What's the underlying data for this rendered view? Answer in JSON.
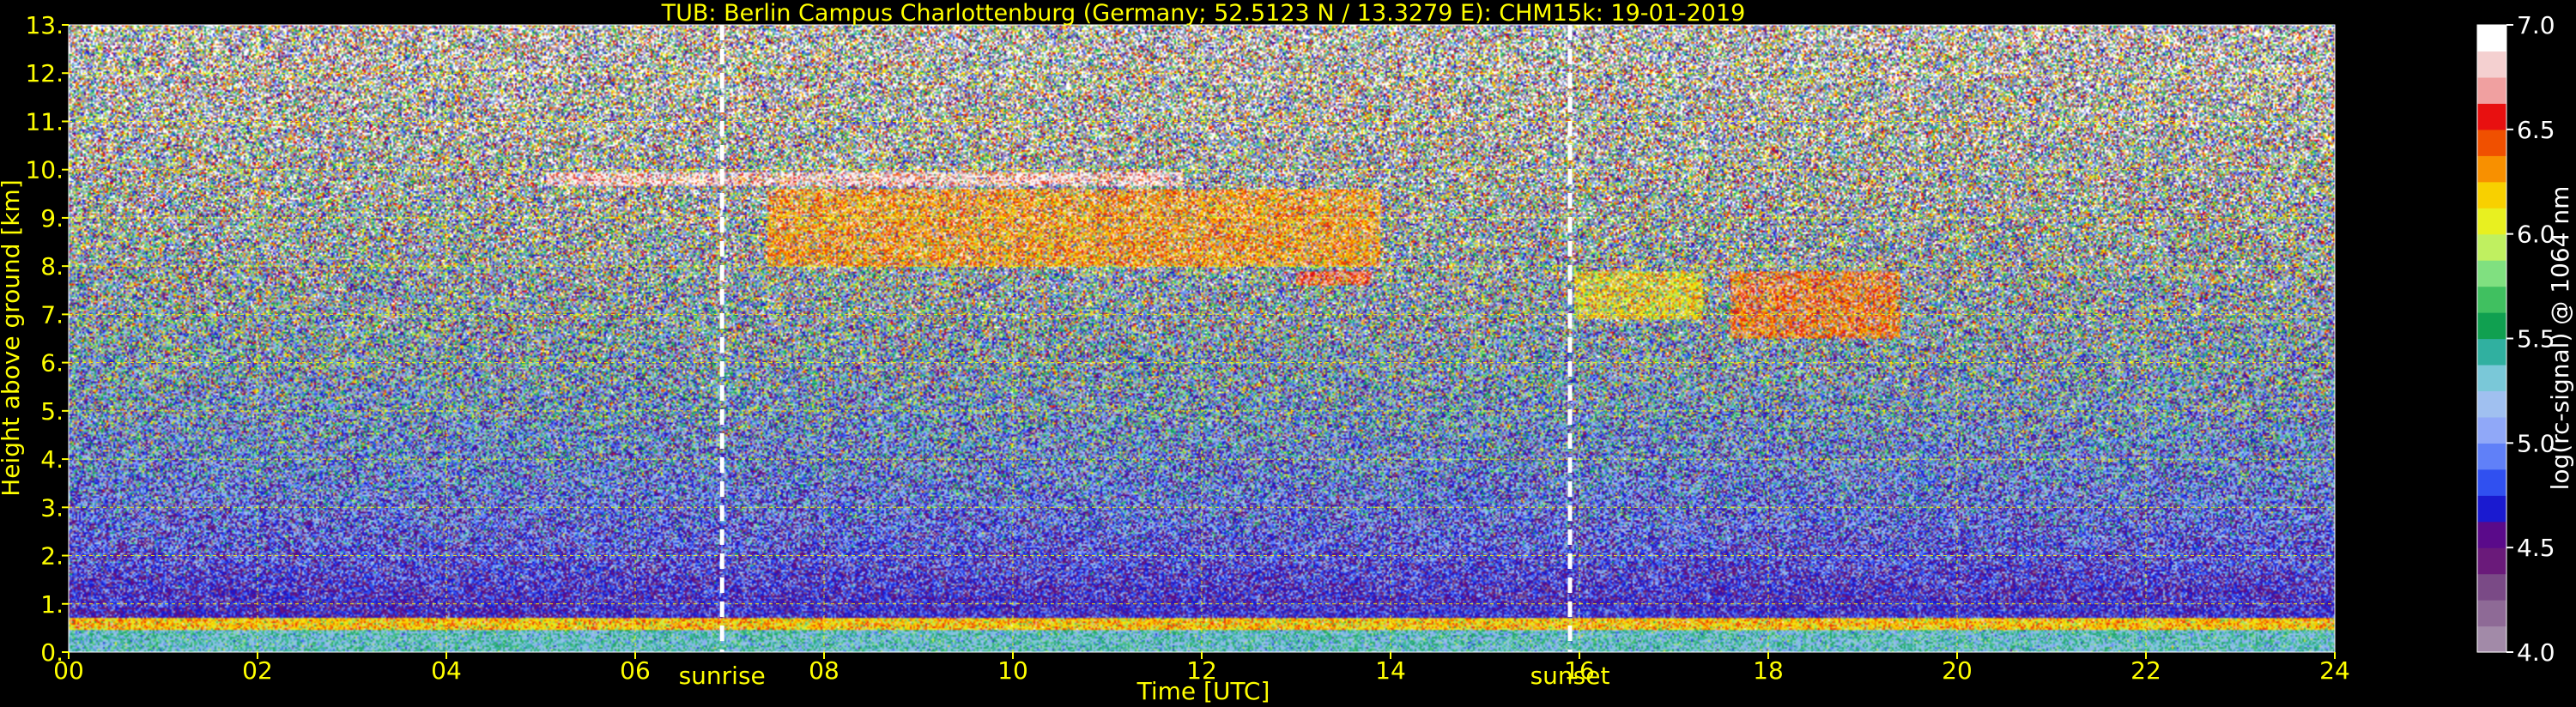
{
  "chart_data": {
    "type": "heatmap",
    "title": "TUB: Berlin Campus Charlottenburg (Germany; 52.5123 N / 13.3279 E):    CHM15k: 19-01-2019",
    "xlabel": "Time [UTC]",
    "ylabel": "Height above ground [km]",
    "xlim": [
      0,
      24
    ],
    "ylim": [
      0,
      13
    ],
    "x_ticks": [
      0,
      2,
      4,
      6,
      8,
      10,
      12,
      14,
      16,
      18,
      20,
      22,
      24
    ],
    "x_tick_labels": [
      "00",
      "02",
      "04",
      "06",
      "08",
      "10",
      "12",
      "14",
      "16",
      "18",
      "20",
      "22",
      "24"
    ],
    "y_ticks": [
      0,
      1,
      2,
      3,
      4,
      5,
      6,
      7,
      8,
      9,
      10,
      11,
      12,
      13
    ],
    "y_tick_labels": [
      "0.",
      "1.",
      "2.",
      "3.",
      "4.",
      "5.",
      "6.",
      "7.",
      "8.",
      "9.",
      "10.",
      "11.",
      "12.",
      "13."
    ],
    "grid": true,
    "colorbar": {
      "label": "log(rc-signal) @ 1064 nm",
      "range": [
        4.0,
        7.0
      ],
      "tick_values": [
        4.0,
        4.5,
        5.0,
        5.5,
        6.0,
        6.5,
        7.0
      ],
      "tick_labels": [
        "4.0",
        "4.5",
        "5.0",
        "5.5",
        "6.0",
        "6.5",
        "7.0"
      ],
      "placement": "right"
    },
    "annotations": [
      {
        "label": "sunrise",
        "time_utc": 6.92,
        "style": "dashed-white-vertical"
      },
      {
        "label": "sunset",
        "time_utc": 15.9,
        "style": "dashed-white-vertical"
      }
    ],
    "features": [
      {
        "kind": "cirrus-thin",
        "t_start": 5.05,
        "t_end": 11.8,
        "h_bottom": 9.65,
        "h_top": 9.95,
        "level": 6.8
      },
      {
        "kind": "cirrus",
        "t_start": 7.4,
        "t_end": 13.9,
        "h_bottom": 8.0,
        "h_top": 9.6,
        "level": 6.3
      },
      {
        "kind": "cirrus-tail",
        "t_start": 13.0,
        "t_end": 13.8,
        "h_bottom": 7.6,
        "h_top": 7.9,
        "level": 6.5
      },
      {
        "kind": "cloud-fragments",
        "t_start": 15.95,
        "t_end": 17.3,
        "h_bottom": 6.9,
        "h_top": 7.9,
        "level": 6.1
      },
      {
        "kind": "cloud",
        "t_start": 17.6,
        "t_end": 19.4,
        "h_bottom": 6.5,
        "h_top": 7.9,
        "level": 6.4
      },
      {
        "kind": "boundary-layer-top",
        "t_start": 0.0,
        "t_end": 24.0,
        "h_bottom": 0.45,
        "h_top": 0.7,
        "level": 6.2
      },
      {
        "kind": "residual-layer",
        "t_start": 5.5,
        "t_end": 24.0,
        "h_bottom": 0.7,
        "h_top": 1.0,
        "level": 4.7
      },
      {
        "kind": "aerosol-near-ground",
        "t_start": 0.0,
        "t_end": 24.0,
        "h_bottom": 0.0,
        "h_top": 0.45,
        "level": 5.35
      }
    ]
  },
  "colors": {
    "axis_text": "#ffff00",
    "colorbar_text": "#ffffff",
    "grid": "#ffff00",
    "background": "#000000",
    "colormap": [
      "#a28aa8",
      "#8e6a96",
      "#7a4a86",
      "#6a1a7a",
      "#5a0a8a",
      "#1a1ad0",
      "#3050f0",
      "#6080f8",
      "#90a8f8",
      "#a0c0f0",
      "#7ac8d8",
      "#30b0a0",
      "#10a050",
      "#40c060",
      "#80e080",
      "#c0f060",
      "#e8f020",
      "#f8d000",
      "#f89000",
      "#f05000",
      "#e81010",
      "#f0a0a0",
      "#f4d0d0",
      "#ffffff"
    ]
  }
}
